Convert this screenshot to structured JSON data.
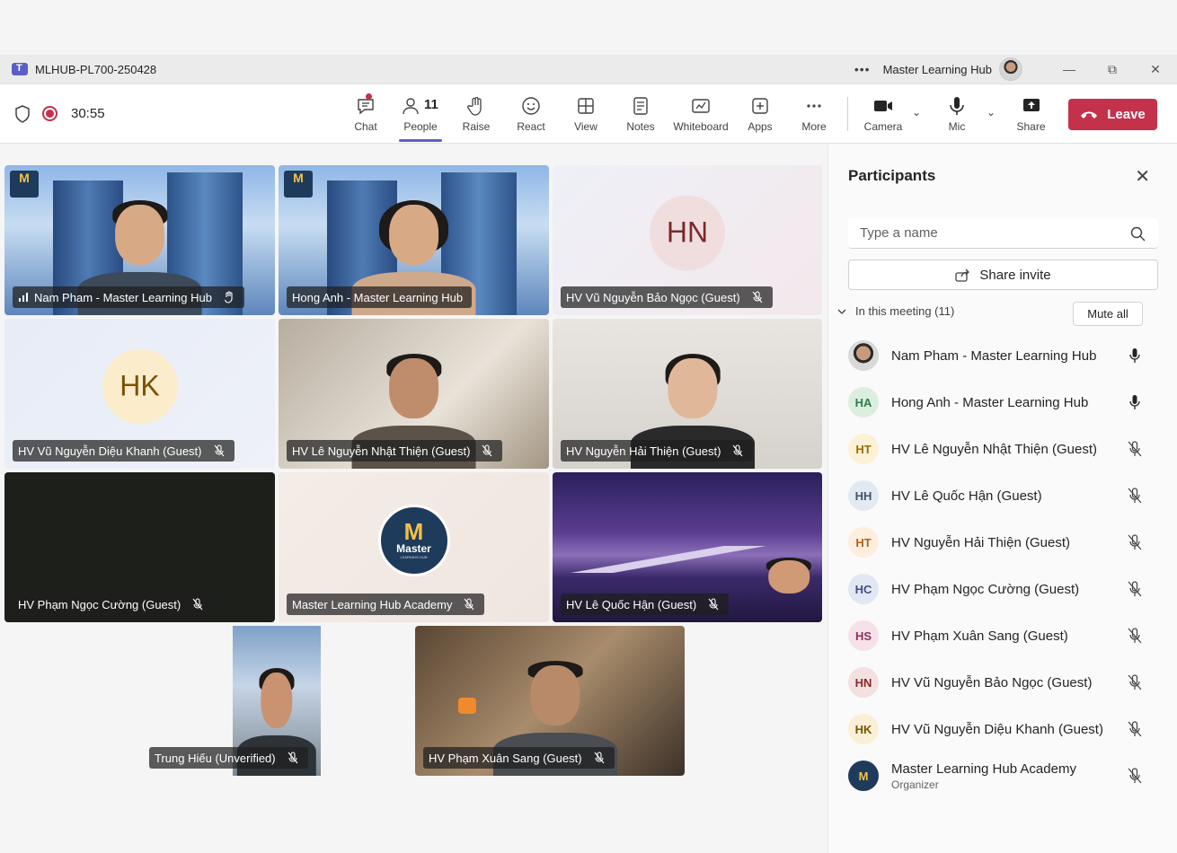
{
  "window": {
    "title": "MLHUB-PL700-250428",
    "more_label": "•••",
    "org_name": "Master Learning Hub",
    "minimize": "—",
    "restore": "⧉",
    "close": "✕"
  },
  "toolbar": {
    "timer": "30:55",
    "chat": "Chat",
    "people": "People",
    "people_count": "11",
    "raise": "Raise",
    "react": "React",
    "view": "View",
    "notes": "Notes",
    "whiteboard": "Whiteboard",
    "apps": "Apps",
    "more": "More",
    "camera": "Camera",
    "mic": "Mic",
    "share": "Share",
    "leave": "Leave",
    "chevron": "⌄"
  },
  "tiles": [
    {
      "name": "Nam Pham - Master Learning Hub"
    },
    {
      "name": "Hong Anh - Master Learning Hub"
    },
    {
      "name": "HV Vũ Nguyễn Bảo Ngọc (Guest)",
      "initials": "HN"
    },
    {
      "name": "HV Vũ Nguyễn Diệu Khanh (Guest)",
      "initials": "HK"
    },
    {
      "name": "HV Lê Nguyễn Nhật Thiện (Guest)"
    },
    {
      "name": "HV Nguyễn Hải Thiện (Guest)"
    },
    {
      "name": "HV Phạm Ngọc Cường (Guest)"
    },
    {
      "name": "Master Learning Hub Academy",
      "logo_text": "Master",
      "logo_sub": "LEARNING HUB"
    },
    {
      "name": "HV Lê Quốc Hận (Guest)"
    },
    {
      "name": "Trung Hiếu (Unverified)"
    },
    {
      "name": "HV Phạm Xuân Sang (Guest)"
    }
  ],
  "panel": {
    "title": "Participants",
    "close": "✕",
    "search_placeholder": "Type a name",
    "share_invite": "Share invite",
    "section_label": "In this meeting (11)",
    "mute_all": "Mute all",
    "participants": [
      {
        "initials": "",
        "name": "Nam Pham - Master Learning Hub",
        "muted": false,
        "color": "#e0e0e0"
      },
      {
        "initials": "HA",
        "name": "Hong Anh - Master Learning Hub",
        "muted": false,
        "color": "#dbeee0",
        "fg": "#2f7d4a"
      },
      {
        "initials": "HT",
        "name": "HV Lê Nguyễn Nhật Thiện (Guest)",
        "muted": true,
        "color": "#fdf1d6",
        "fg": "#a06b00"
      },
      {
        "initials": "HH",
        "name": "HV Lê Quốc Hận (Guest)",
        "muted": true,
        "color": "#e3e9f0",
        "fg": "#3d5470"
      },
      {
        "initials": "HT",
        "name": "HV Nguyễn Hải Thiện (Guest)",
        "muted": true,
        "color": "#fdeede",
        "fg": "#b0621a"
      },
      {
        "initials": "HC",
        "name": "HV Phạm Ngọc Cường (Guest)",
        "muted": true,
        "color": "#e3e7f4",
        "fg": "#3e4f86"
      },
      {
        "initials": "HS",
        "name": "HV Phạm Xuân Sang (Guest)",
        "muted": true,
        "color": "#f5e1ea",
        "fg": "#8f2f5c"
      },
      {
        "initials": "HN",
        "name": "HV Vũ Nguyễn Bảo Ngọc (Guest)",
        "muted": true,
        "color": "#f3e0e0",
        "fg": "#8a2a2a"
      },
      {
        "initials": "HK",
        "name": "HV Vũ Nguyễn Diệu Khanh (Guest)",
        "muted": true,
        "color": "#fbefd6",
        "fg": "#7a5200"
      },
      {
        "initials": "",
        "name": "Master Learning Hub Academy",
        "sub": "Organizer",
        "muted": true,
        "color": "#1f3b5b"
      }
    ]
  }
}
